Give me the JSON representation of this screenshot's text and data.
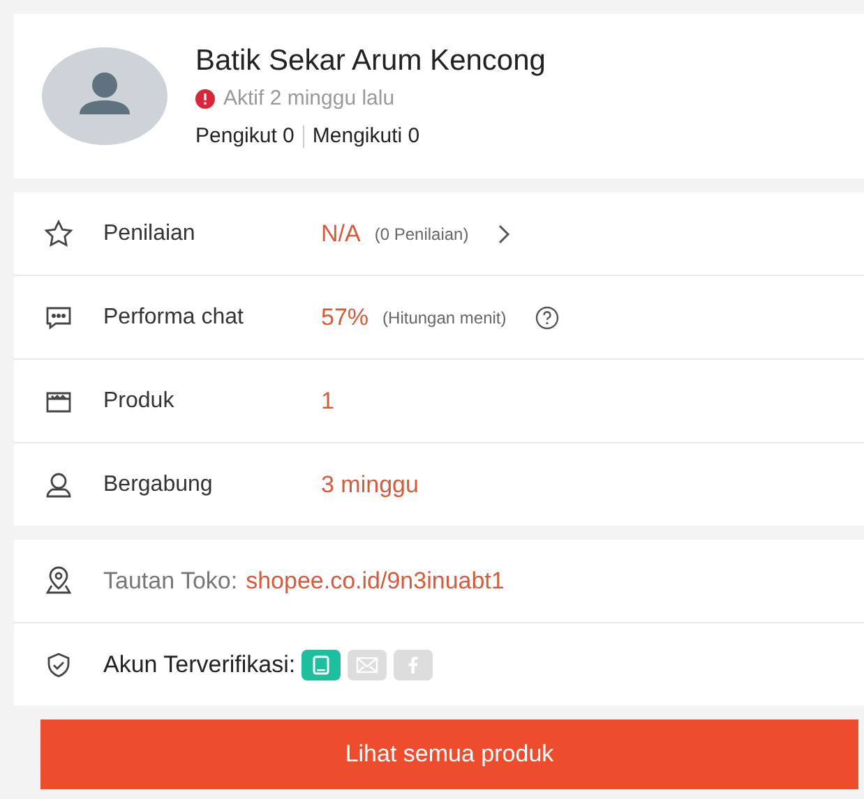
{
  "profile": {
    "name": "Batik Sekar Arum Kencong",
    "status": "Aktif 2 minggu lalu",
    "followers": "Pengikut 0",
    "following": "Mengikuti 0"
  },
  "stats": [
    {
      "kind": "rating",
      "label": "Penilaian",
      "value": "N/A",
      "note": "(0 Penilaian)",
      "trailing": {
        "kind": "chevron"
      }
    },
    {
      "kind": "chat",
      "label": "Performa chat",
      "value": "57%",
      "note": "(Hitungan menit)",
      "trailing": {
        "kind": "help"
      }
    },
    {
      "kind": "product",
      "label": "Produk",
      "value": "1"
    },
    {
      "kind": "joined",
      "label": "Bergabung",
      "value": "3 minggu"
    }
  ],
  "shop_link": {
    "label": "Tautan Toko:",
    "url": "shopee.co.id/9n3inuabt1"
  },
  "verified": {
    "label": "Akun Terverifikasi:",
    "badges": [
      {
        "kind": "phone",
        "verified": true
      },
      {
        "kind": "email",
        "verified": false
      },
      {
        "kind": "facebook",
        "verified": false
      }
    ]
  },
  "button": "Lihat semua produk"
}
